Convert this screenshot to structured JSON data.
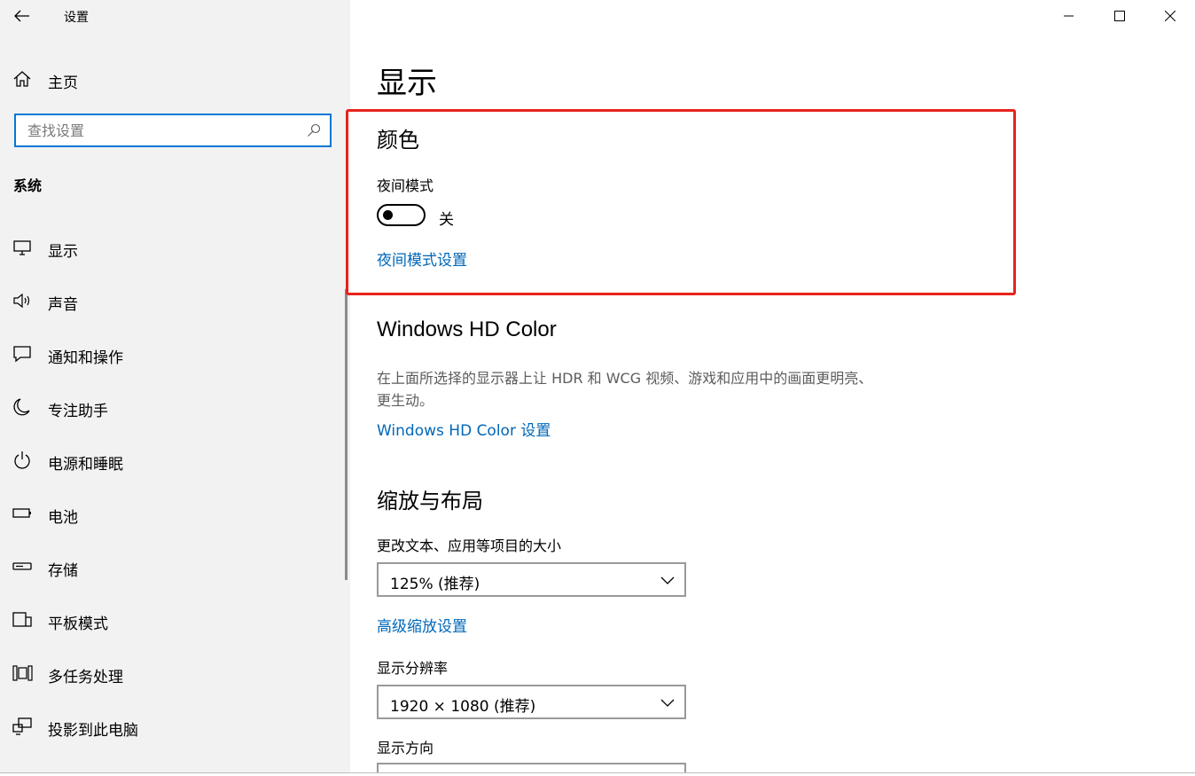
{
  "window": {
    "app_title": "设置",
    "controls": [
      "minimize-icon",
      "maximize-icon",
      "close-icon"
    ]
  },
  "sidebar": {
    "home_label": "主页",
    "search_placeholder": "查找设置",
    "section": "系统",
    "items": [
      {
        "label": "显示",
        "icon": "monitor-icon"
      },
      {
        "label": "声音",
        "icon": "speaker-icon"
      },
      {
        "label": "通知和操作",
        "icon": "notification-icon"
      },
      {
        "label": "专注助手",
        "icon": "moon-icon"
      },
      {
        "label": "电源和睡眠",
        "icon": "power-icon"
      },
      {
        "label": "电池",
        "icon": "battery-icon"
      },
      {
        "label": "存储",
        "icon": "storage-icon"
      },
      {
        "label": "平板模式",
        "icon": "tablet-icon"
      },
      {
        "label": "多任务处理",
        "icon": "multitask-icon"
      },
      {
        "label": "投影到此电脑",
        "icon": "project-icon"
      }
    ]
  },
  "main": {
    "title": "显示",
    "color": {
      "heading": "颜色",
      "night_mode_label": "夜间模式",
      "toggle_state": "关",
      "night_mode_on": false,
      "night_mode_link": "夜间模式设置"
    },
    "hd_color": {
      "heading": "Windows HD Color",
      "description": "在上面所选择的显示器上让 HDR 和 WCG 视频、游戏和应用中的画面更明亮、更生动。",
      "link": "Windows HD Color 设置"
    },
    "scale": {
      "heading": "缩放与布局",
      "text_size_label": "更改文本、应用等项目的大小",
      "text_size_value": "125% (推荐)",
      "advanced_link": "高级缩放设置",
      "resolution_label": "显示分辨率",
      "resolution_value": "1920 × 1080 (推荐)",
      "orientation_label": "显示方向"
    }
  },
  "colors": {
    "accent": "#0078d7",
    "link": "#0067b8",
    "highlight_box": "#e8231c",
    "sidebar_bg": "#f2f2f2"
  }
}
